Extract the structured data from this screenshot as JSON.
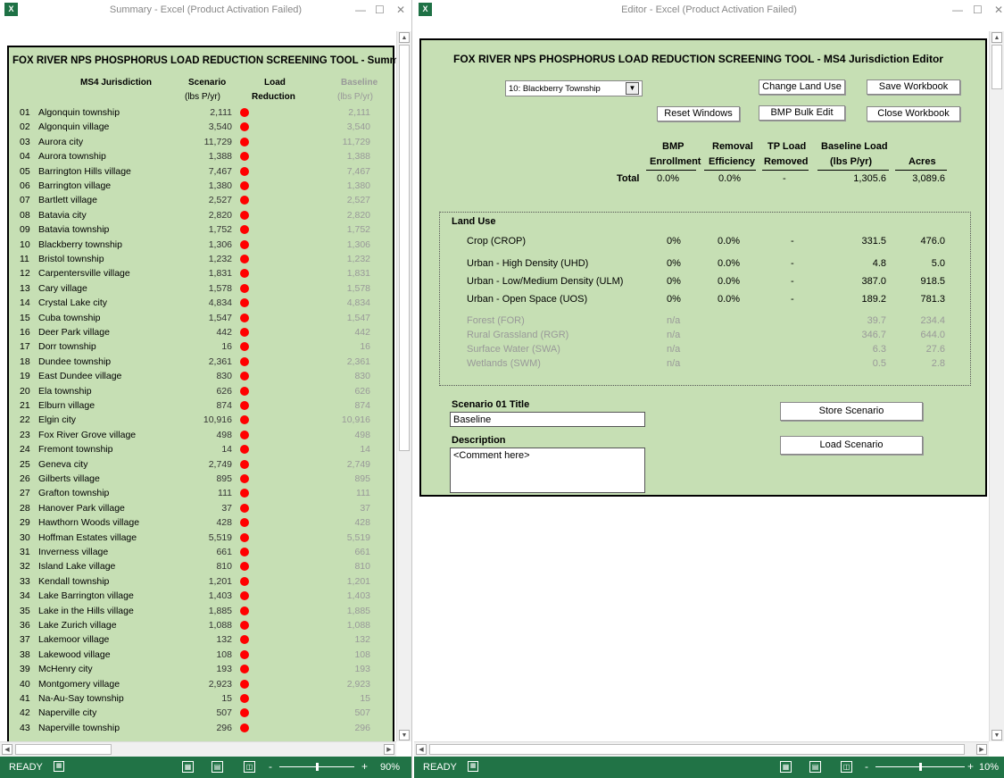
{
  "left": {
    "title": "Summary - Excel (Product Activation Failed)",
    "app_icon": "X",
    "heading": "FOX RIVER NPS PHOSPHORUS LOAD REDUCTION SCREENING TOOL - Summary",
    "col_ms4": "MS4 Jurisdiction",
    "col_scenario": "Scenario",
    "col_scenario_unit": "(lbs P/yr)",
    "col_load": "Load",
    "col_reduction": "Reduction",
    "col_baseline": "Baseline",
    "col_baseline_unit": "(lbs P/yr)",
    "rows": [
      {
        "num": "01",
        "name": "Algonquin township",
        "scenario": "2,111",
        "baseline": "2,111"
      },
      {
        "num": "02",
        "name": "Algonquin village",
        "scenario": "3,540",
        "baseline": "3,540"
      },
      {
        "num": "03",
        "name": "Aurora city",
        "scenario": "11,729",
        "baseline": "11,729"
      },
      {
        "num": "04",
        "name": "Aurora township",
        "scenario": "1,388",
        "baseline": "1,388"
      },
      {
        "num": "05",
        "name": "Barrington Hills village",
        "scenario": "7,467",
        "baseline": "7,467"
      },
      {
        "num": "06",
        "name": "Barrington village",
        "scenario": "1,380",
        "baseline": "1,380"
      },
      {
        "num": "07",
        "name": "Bartlett village",
        "scenario": "2,527",
        "baseline": "2,527"
      },
      {
        "num": "08",
        "name": "Batavia city",
        "scenario": "2,820",
        "baseline": "2,820"
      },
      {
        "num": "09",
        "name": "Batavia township",
        "scenario": "1,752",
        "baseline": "1,752"
      },
      {
        "num": "10",
        "name": "Blackberry township",
        "scenario": "1,306",
        "baseline": "1,306"
      },
      {
        "num": "11",
        "name": "Bristol township",
        "scenario": "1,232",
        "baseline": "1,232"
      },
      {
        "num": "12",
        "name": "Carpentersville village",
        "scenario": "1,831",
        "baseline": "1,831"
      },
      {
        "num": "13",
        "name": "Cary village",
        "scenario": "1,578",
        "baseline": "1,578"
      },
      {
        "num": "14",
        "name": "Crystal Lake city",
        "scenario": "4,834",
        "baseline": "4,834"
      },
      {
        "num": "15",
        "name": "Cuba township",
        "scenario": "1,547",
        "baseline": "1,547"
      },
      {
        "num": "16",
        "name": "Deer Park village",
        "scenario": "442",
        "baseline": "442"
      },
      {
        "num": "17",
        "name": "Dorr township",
        "scenario": "16",
        "baseline": "16"
      },
      {
        "num": "18",
        "name": "Dundee township",
        "scenario": "2,361",
        "baseline": "2,361"
      },
      {
        "num": "19",
        "name": "East Dundee village",
        "scenario": "830",
        "baseline": "830"
      },
      {
        "num": "20",
        "name": "Ela township",
        "scenario": "626",
        "baseline": "626"
      },
      {
        "num": "21",
        "name": "Elburn village",
        "scenario": "874",
        "baseline": "874"
      },
      {
        "num": "22",
        "name": "Elgin city",
        "scenario": "10,916",
        "baseline": "10,916"
      },
      {
        "num": "23",
        "name": "Fox River Grove village",
        "scenario": "498",
        "baseline": "498"
      },
      {
        "num": "24",
        "name": "Fremont township",
        "scenario": "14",
        "baseline": "14"
      },
      {
        "num": "25",
        "name": "Geneva city",
        "scenario": "2,749",
        "baseline": "2,749"
      },
      {
        "num": "26",
        "name": "Gilberts village",
        "scenario": "895",
        "baseline": "895"
      },
      {
        "num": "27",
        "name": "Grafton township",
        "scenario": "111",
        "baseline": "111"
      },
      {
        "num": "28",
        "name": "Hanover Park village",
        "scenario": "37",
        "baseline": "37"
      },
      {
        "num": "29",
        "name": "Hawthorn Woods village",
        "scenario": "428",
        "baseline": "428"
      },
      {
        "num": "30",
        "name": "Hoffman Estates village",
        "scenario": "5,519",
        "baseline": "5,519"
      },
      {
        "num": "31",
        "name": "Inverness village",
        "scenario": "661",
        "baseline": "661"
      },
      {
        "num": "32",
        "name": "Island Lake village",
        "scenario": "810",
        "baseline": "810"
      },
      {
        "num": "33",
        "name": "Kendall township",
        "scenario": "1,201",
        "baseline": "1,201"
      },
      {
        "num": "34",
        "name": "Lake Barrington village",
        "scenario": "1,403",
        "baseline": "1,403"
      },
      {
        "num": "35",
        "name": "Lake in the Hills village",
        "scenario": "1,885",
        "baseline": "1,885"
      },
      {
        "num": "36",
        "name": "Lake Zurich village",
        "scenario": "1,088",
        "baseline": "1,088"
      },
      {
        "num": "37",
        "name": "Lakemoor village",
        "scenario": "132",
        "baseline": "132"
      },
      {
        "num": "38",
        "name": "Lakewood village",
        "scenario": "108",
        "baseline": "108"
      },
      {
        "num": "39",
        "name": "McHenry city",
        "scenario": "193",
        "baseline": "193"
      },
      {
        "num": "40",
        "name": "Montgomery village",
        "scenario": "2,923",
        "baseline": "2,923"
      },
      {
        "num": "41",
        "name": "Na-Au-Say township",
        "scenario": "15",
        "baseline": "15"
      },
      {
        "num": "42",
        "name": "Naperville city",
        "scenario": "507",
        "baseline": "507"
      },
      {
        "num": "43",
        "name": "Naperville township",
        "scenario": "296",
        "baseline": "296"
      }
    ],
    "status_ready": "READY",
    "zoom": "90%",
    "zoom_minus": "-",
    "zoom_plus": "+",
    "zoom_level": 0.5
  },
  "right": {
    "title": "Editor - Excel (Product Activation Failed)",
    "app_icon": "X",
    "heading": "FOX RIVER NPS PHOSPHORUS LOAD REDUCTION SCREENING TOOL - MS4 Jurisdiction Editor",
    "dropdown_value": "10: Blackberry Township",
    "btn_change": "Change Land Use",
    "btn_save": "Save Workbook",
    "btn_reset": "Reset Windows",
    "btn_bmp": "BMP Bulk Edit",
    "btn_close": "Close Workbook",
    "h_bmp1": "BMP",
    "h_bmp2": "Enrollment",
    "h_rem1": "Removal",
    "h_rem2": "Efficiency",
    "h_tp1": "TP Load",
    "h_tp2": "Removed",
    "h_base1": "Baseline Load",
    "h_base2": "(lbs P/yr)",
    "h_acres": "Acres",
    "total_label": "Total",
    "total": {
      "bmp": "0.0%",
      "rem": "0.0%",
      "tp": "-",
      "base": "1,305.6",
      "acres": "3,089.6"
    },
    "land_use_label": "Land Use",
    "land_uses": [
      {
        "name": "Crop (CROP)",
        "bmp": "0%",
        "rem": "0.0%",
        "tp": "-",
        "base": "331.5",
        "acres": "476.0"
      },
      {
        "name": "Urban - High Density (UHD)",
        "bmp": "0%",
        "rem": "0.0%",
        "tp": "-",
        "base": "4.8",
        "acres": "5.0"
      },
      {
        "name": "Urban - Low/Medium Density (ULM)",
        "bmp": "0%",
        "rem": "0.0%",
        "tp": "-",
        "base": "387.0",
        "acres": "918.5"
      },
      {
        "name": "Urban - Open Space (UOS)",
        "bmp": "0%",
        "rem": "0.0%",
        "tp": "-",
        "base": "189.2",
        "acres": "781.3"
      }
    ],
    "other_uses": [
      {
        "name": "Forest (FOR)",
        "bmp": "n/a",
        "base": "39.7",
        "acres": "234.4"
      },
      {
        "name": "Rural Grassland (RGR)",
        "bmp": "n/a",
        "base": "346.7",
        "acres": "644.0"
      },
      {
        "name": "Surface Water (SWA)",
        "bmp": "n/a",
        "base": "6.3",
        "acres": "27.6"
      },
      {
        "name": "Wetlands (SWM)",
        "bmp": "n/a",
        "base": "0.5",
        "acres": "2.8"
      }
    ],
    "scenario_title_label": "Scenario 01 Title",
    "scenario_title_value": "Baseline",
    "description_label": "Description",
    "description_value": "<Comment here>",
    "btn_store": "Store Scenario",
    "btn_load": "Load Scenario",
    "status_ready": "READY",
    "zoom": "10%",
    "zoom_minus": "-",
    "zoom_plus": "+",
    "zoom_level": 0.5
  }
}
